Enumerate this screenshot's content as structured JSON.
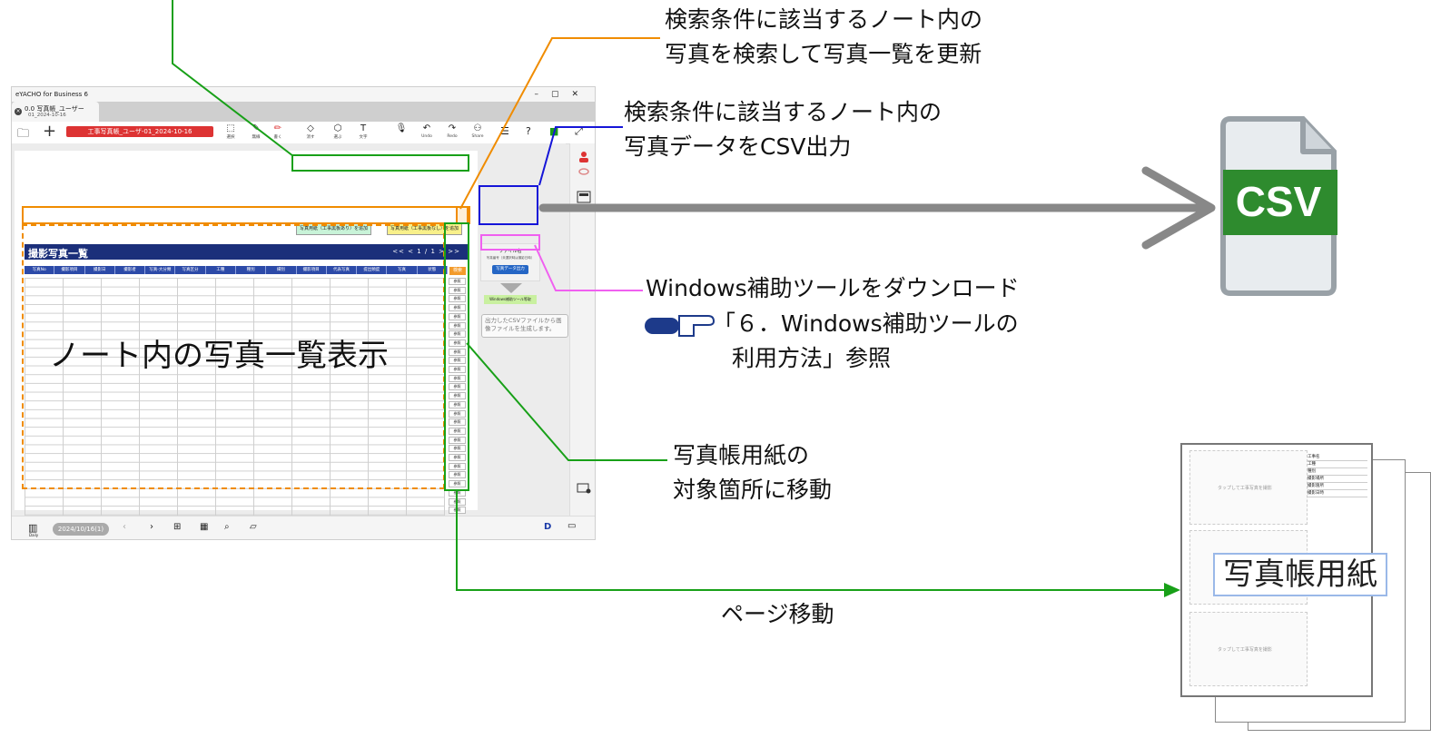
{
  "app": {
    "window_title": "eYACHO for Business 6",
    "tab_name": "0.0 写真帳_ユーザー",
    "tab_sub": "01_2024-10-16",
    "doc_name": "工事写真帳_ユーザ-01_2024-10-16",
    "tools": [
      {
        "icon": "select-icon",
        "label": "選択"
      },
      {
        "icon": "pen-icon",
        "label": "無線"
      },
      {
        "icon": "marker-icon",
        "label": "書く"
      },
      {
        "icon": "eraser-icon",
        "label": "消す"
      },
      {
        "icon": "lasso-icon",
        "label": "選ぶ"
      },
      {
        "icon": "text-icon",
        "label": "文字"
      },
      {
        "icon": "mic-icon",
        "label": ""
      },
      {
        "icon": "undo-icon",
        "label": "Undo"
      },
      {
        "icon": "redo-icon",
        "label": "Redo"
      },
      {
        "icon": "share-icon",
        "label": "Share"
      }
    ],
    "add_photo_with_board": "写真用紙（工事黒板あり）を追加",
    "add_photo_without_board": "写真用紙（工事黒板なし）を追加",
    "list_title": "撮影写真一覧",
    "pager": "<< <  1  /  1  > >>",
    "columns": [
      "写真No",
      "撮影項目",
      "撮影日",
      "撮影者",
      "写真-大分類",
      "写真区分",
      "工種",
      "種別",
      "細別",
      "撮影項目",
      "代表写真",
      "提出頻度",
      "写真",
      "状態"
    ],
    "search_label": "検索",
    "ref_label": "参照",
    "file_name_label": "ファイル名",
    "file_name_value": "写真番号（未選択時は撮影日時）",
    "csv_output_label": "写真データ出力",
    "windows_tool_label": "Windows補助ツール等取",
    "tip_text": "出力したCSVファイルから画像ファイルを生成します。",
    "bottom_date": "2024/10/16(1)",
    "daily_label": "Daily"
  },
  "callouts": {
    "search": [
      "検索条件に該当するノート内の",
      "写真を検索して写真一覧を更新"
    ],
    "csv": [
      "検索条件に該当するノート内の",
      "写真データをCSV出力"
    ],
    "windows_tool": "Windows補助ツールをダウンロード",
    "ref_section_1": "「６．Windows補助ツールの",
    "ref_section_2": "利用方法」参照",
    "list_display": "ノート内の写真一覧表示",
    "move": [
      "写真帳用紙の",
      "対象箇所に移動"
    ],
    "page_move": "ページ移動",
    "photo_paper": "写真帳用紙",
    "csv_badge": "CSV"
  },
  "colors": {
    "green": "#18a018",
    "orange": "#f08c00",
    "blue": "#1515d8",
    "magenta": "#f060f0",
    "gray_arrow": "#888888",
    "csv_green": "#2e8b2e",
    "header_navy": "#1b2f7a"
  },
  "sheet": {
    "photo_hint": "タップして工事写真を撮影",
    "fields": [
      "工事名",
      "工種",
      "種別",
      "撮影場所",
      "撮影箇所",
      "撮影日時"
    ]
  }
}
